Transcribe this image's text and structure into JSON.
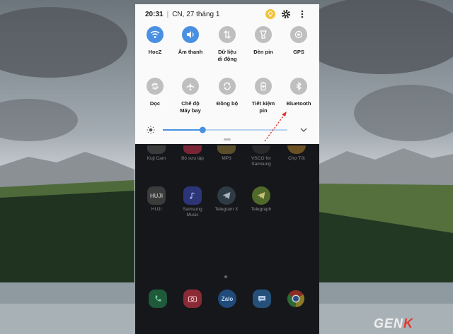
{
  "status_bar": {
    "time": "20:31",
    "date": "CN, 27 tháng 1"
  },
  "status_icons": [
    "bulb-icon",
    "gear-icon",
    "more-vert-icon"
  ],
  "quick_tiles_row1": [
    {
      "label": "HocZ",
      "icon": "wifi-icon",
      "on": true
    },
    {
      "label": "Âm thanh",
      "icon": "volume-icon",
      "on": true
    },
    {
      "label": "Dữ liệu\ndi động",
      "icon": "mobile-data-icon",
      "on": false
    },
    {
      "label": "Đèn pin",
      "icon": "flashlight-icon",
      "on": false
    },
    {
      "label": "GPS",
      "icon": "gps-icon",
      "on": false
    }
  ],
  "quick_tiles_row2": [
    {
      "label": "Dọc",
      "icon": "rotation-icon",
      "on": false
    },
    {
      "label": "Chế độ\nMáy bay",
      "icon": "airplane-icon",
      "on": false
    },
    {
      "label": "Đồng bộ",
      "icon": "sync-icon",
      "on": false
    },
    {
      "label": "Tiết kiệm\npin",
      "icon": "battery-saver-icon",
      "on": false
    },
    {
      "label": "Bluetooth",
      "icon": "bluetooth-icon",
      "on": false
    }
  ],
  "brightness": {
    "level": 0.32
  },
  "apps_row1": [
    "Kuji Cam",
    "Bộ sưu tập",
    "MP3",
    "VSCO for\nSamsung",
    "Chợ Tốt"
  ],
  "apps_row2": [
    "HUJI",
    "Samsung\nMusic",
    "Telegram X",
    "Telegraph"
  ],
  "icon_text": {
    "huji": "HUJI",
    "zalo": "Zalo"
  },
  "dock_icons": [
    "phone-icon",
    "camera-icon",
    "zalo-icon",
    "messages-icon",
    "chrome-icon"
  ],
  "watermark": {
    "pre": "GEN",
    "accent": "K"
  },
  "colors": {
    "accent": "#4a90e2",
    "annotation": "#d9342b"
  }
}
